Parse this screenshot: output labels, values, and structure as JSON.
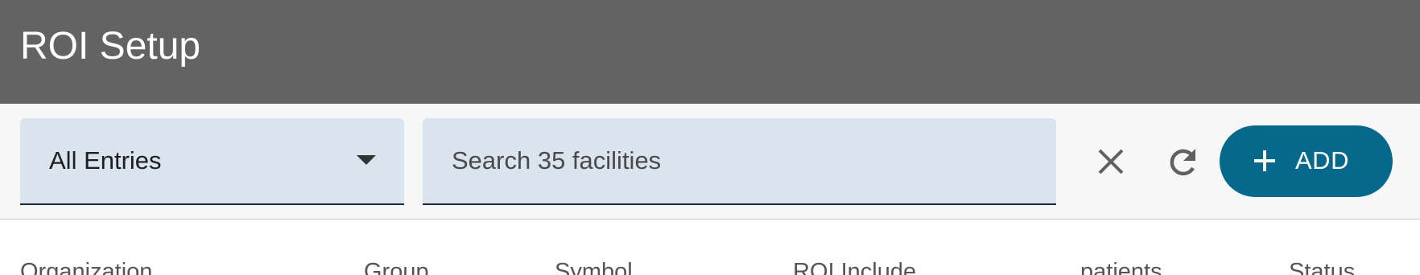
{
  "header": {
    "title": "ROI Setup"
  },
  "toolbar": {
    "filter_select": {
      "value": "All Entries"
    },
    "search": {
      "placeholder": "Search 35 facilities",
      "value": ""
    },
    "add_label": "ADD",
    "icons": {
      "clear": "close-icon",
      "refresh": "refresh-icon",
      "add": "plus-icon",
      "dropdown": "caret-down-icon"
    }
  },
  "table": {
    "columns": [
      "Organization",
      "Group",
      "Symbol",
      "ROI Include",
      "patients",
      "Status"
    ]
  },
  "colors": {
    "header_bg": "#636363",
    "toolbar_bg": "#f7f7f7",
    "field_bg": "#d9e4ee",
    "accent": "#06698b"
  }
}
